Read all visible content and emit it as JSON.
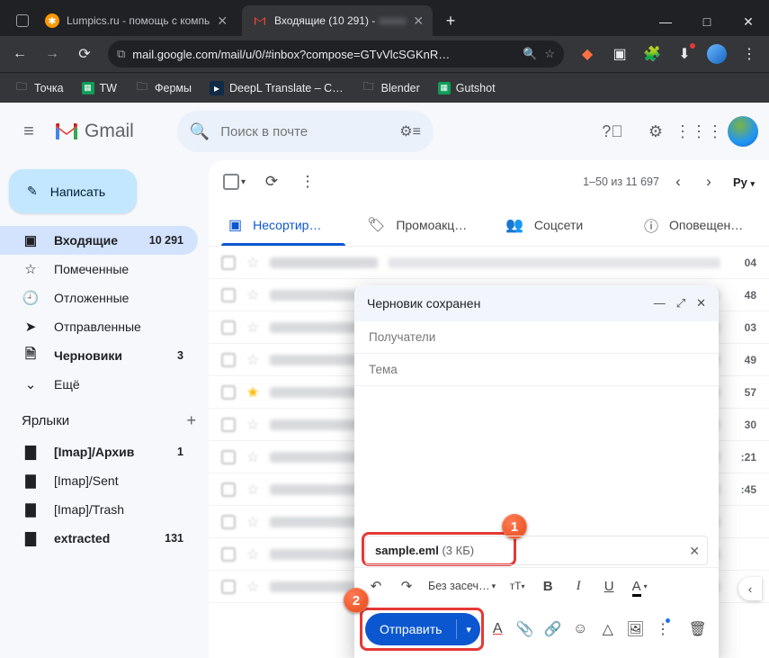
{
  "browser": {
    "tabs": [
      {
        "title": "Lumpics.ru - помощь с компь",
        "favicon_bg": "#ff9800",
        "favicon_text": "✱"
      },
      {
        "title": "Входящие (10 291) -",
        "favicon_text": "M"
      }
    ],
    "url": "mail.google.com/mail/u/0/#inbox?compose=GTvVlcSGKnR…",
    "bookmarks": [
      {
        "label": "Точка",
        "icon": "folder"
      },
      {
        "label": "TW",
        "icon": "sheet"
      },
      {
        "label": "Фермы",
        "icon": "folder"
      },
      {
        "label": "DeepL Translate – C…",
        "icon": "deepl"
      },
      {
        "label": "Blender",
        "icon": "folder"
      },
      {
        "label": "Gutshot",
        "icon": "sheet"
      }
    ]
  },
  "gmail": {
    "brand": "Gmail",
    "search_placeholder": "Поиск в почте",
    "compose_label": "Написать",
    "sidebar": [
      {
        "icon": "inbox",
        "label": "Входящие",
        "count": "10 291",
        "active": true
      },
      {
        "icon": "star",
        "label": "Помеченные"
      },
      {
        "icon": "clock",
        "label": "Отложенные"
      },
      {
        "icon": "send",
        "label": "Отправленные"
      },
      {
        "icon": "draft",
        "label": "Черновики",
        "count": "3",
        "bold": true
      },
      {
        "icon": "more",
        "label": "Ещё"
      }
    ],
    "labels_header": "Ярлыки",
    "labels": [
      {
        "label": "[Imap]/Архив",
        "count": "1",
        "bold": true
      },
      {
        "label": "[Imap]/Sent"
      },
      {
        "label": "[Imap]/Trash"
      },
      {
        "label": "extracted",
        "count": "131",
        "bold": true
      }
    ],
    "pagination": "1–50 из 11 697",
    "lang_toggle": "Ру",
    "categories": [
      {
        "label": "Несортир…",
        "active": true
      },
      {
        "label": "Промоакц…"
      },
      {
        "label": "Соцсети"
      },
      {
        "label": "Оповещен…"
      }
    ],
    "row_times": [
      "04",
      "48",
      "03",
      "49",
      "57",
      "30",
      ":21",
      ":45",
      "",
      "",
      ""
    ]
  },
  "compose": {
    "status": "Черновик сохранен",
    "recipients_label": "Получатели",
    "subject_label": "Тема",
    "attachment_name": "sample.eml",
    "attachment_size": "(3 КБ)",
    "font_label": "Без засеч…",
    "send_label": "Отправить"
  },
  "annotations": {
    "badge1": "1",
    "badge2": "2"
  },
  "colors": {
    "accent": "#0b57d0",
    "highlight": "#e53935"
  }
}
